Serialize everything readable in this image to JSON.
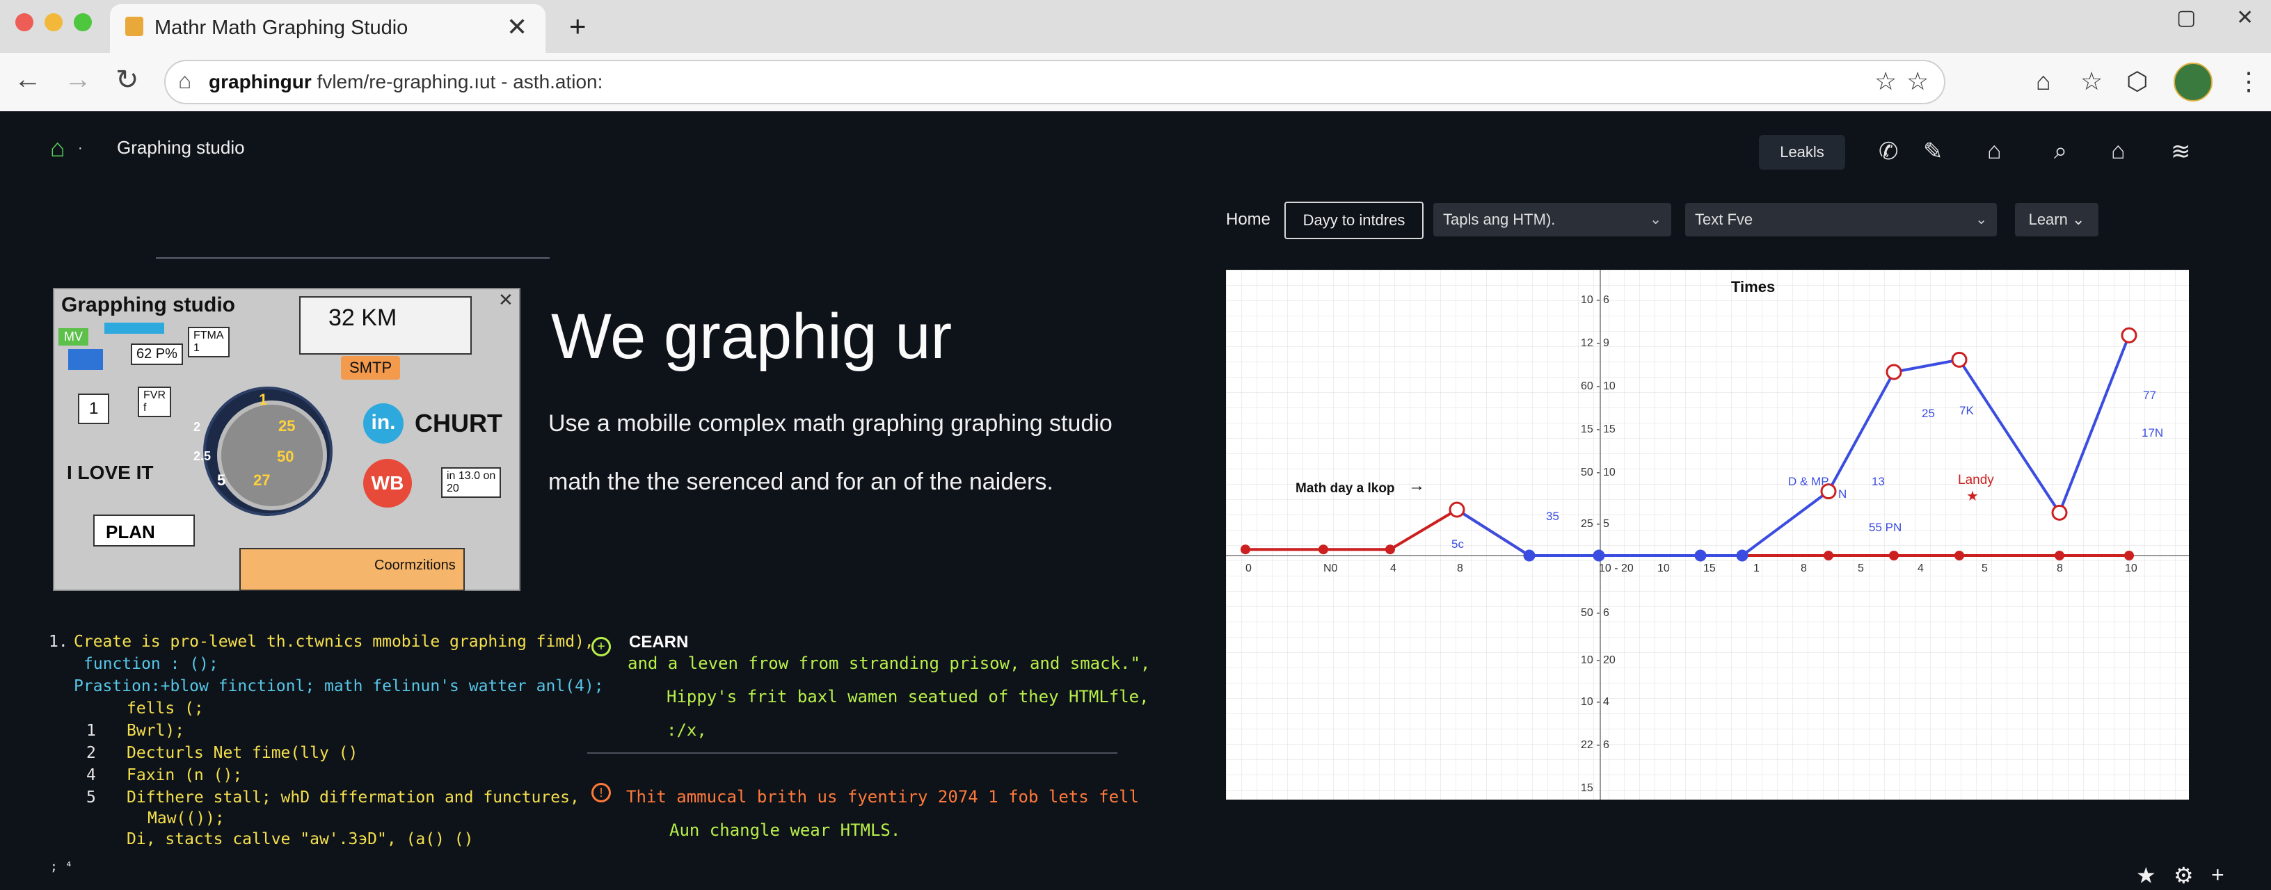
{
  "browser": {
    "tab_title": "Mathr Math Graphing Studio",
    "url_bold": "graphingur",
    "url_rest": " fvlem/re-graphing.ıut - asth.ation:"
  },
  "header": {
    "brand": "Graphing studio",
    "pill": "Leakls"
  },
  "toolbar": {
    "home": "Home",
    "day": "Dayy to intdres",
    "select1": "Tapls ang HTM).",
    "select2": "Text Fve",
    "learn": "Learn"
  },
  "thumbnail": {
    "title": "Grapphing studio",
    "km": "32 KM",
    "mv": "MV",
    "pct": "62 P%",
    "ftma": "FTMA\n1",
    "smtp": "SMTP",
    "churt": "CHURT",
    "in_badge": "in.",
    "wb_badge": "WB",
    "i_love": "I LOVE IT",
    "plan": "PLAN",
    "one": "1",
    "fvr": "FVR\nf",
    "info": "in 13.0 on\n20",
    "cormz": "Coormzitions",
    "dial": [
      "1",
      "25",
      "50",
      "27",
      "5",
      "2",
      "2.5"
    ]
  },
  "hero": {
    "title": "We graphig ur",
    "sub1": "Use a mobille complex math graphing graphing studio",
    "sub2": "math the the serenced and for an of the naiders."
  },
  "code": {
    "lines": [
      {
        "num": "1.",
        "text": "Create is pro-lewel th.ctwnics mmobile graphing fimd),",
        "color": "y"
      },
      {
        "num": "",
        "text": "function : ();",
        "color": "c"
      },
      {
        "num": "",
        "text": "Prastion:+blow finctionl; math felinun's watter anl(4);",
        "color": "c"
      },
      {
        "num": "",
        "text": "fells (;",
        "color": "y"
      },
      {
        "num": "1",
        "text": "Bwrl);",
        "color": "y"
      },
      {
        "num": "2",
        "text": "Decturls Net fime(lly ()",
        "color": "y"
      },
      {
        "num": "4",
        "text": "Faxin (n ();",
        "color": "y"
      },
      {
        "num": "5",
        "text": "Difthere stall; whD differmation and functures,",
        "color": "y"
      },
      {
        "num": "",
        "text": "Maw(());",
        "color": "y"
      },
      {
        "num": "",
        "text": "Di, stacts callve \"aw'.3эD\", (a() ()",
        "color": "y"
      }
    ],
    "prompt": "; ⁴"
  },
  "notes": {
    "cearn_title": "CEARN",
    "cearn_lines": [
      "and a leven frow from stranding prisow, and smack.\",",
      "Hippy's frit baxl wamen seatued of they HTMLfle,",
      ":/x,"
    ],
    "warn_lines": [
      "Thit ammucal brith us fyentiry 2074 1 fob lets fell",
      "Aun changle wear HTMLS."
    ]
  },
  "colors": {
    "background": "#0e1219",
    "green": "#5ad15a",
    "red_series": "#cc1f1f",
    "blue_series": "#3a4de0",
    "code_yellow": "#f4e04d",
    "code_cyan": "#57c7e8",
    "note_green": "#b8ef4a",
    "note_orange": "#ff7a3a"
  },
  "chart_data": {
    "type": "line",
    "title": "Times",
    "x_ticks": [
      "0",
      "N0",
      "4",
      "8",
      "10 - 20",
      "10",
      "15",
      "1",
      "8",
      "5",
      "4",
      "5",
      "8",
      "10"
    ],
    "y_ticks_upper": [
      "10 - 6",
      "12 - 9",
      "60 - 10",
      "15 - 15",
      "50 - 10",
      "25 - 5"
    ],
    "y_ticks_lower": [
      "50 - 6",
      "10 - 20",
      "10 - 4",
      "22 - 6",
      "15"
    ],
    "x": [
      0,
      1,
      3,
      4,
      5,
      6,
      7,
      8,
      9,
      10,
      11,
      12,
      13
    ],
    "series": [
      {
        "color": "#cc1f1f",
        "values": [
          0.2,
          0.2,
          0.2,
          1.5,
          0,
          0,
          0,
          0,
          0,
          0,
          0,
          0,
          0
        ]
      },
      {
        "color": "#3a4de0",
        "values": [
          null,
          null,
          null,
          1.5,
          0,
          0,
          0,
          0,
          2.1,
          6.0,
          6.4,
          1.4,
          7.2
        ]
      }
    ],
    "annotations": {
      "label_left": "Math day a lkop",
      "a": "5c",
      "b": "35",
      "c": "D & MP.",
      "d": "N",
      "e": "13",
      "f": "25",
      "g": "7K",
      "h": "55 PN",
      "i": "Landy",
      "j": "77",
      "k": "17N"
    }
  }
}
